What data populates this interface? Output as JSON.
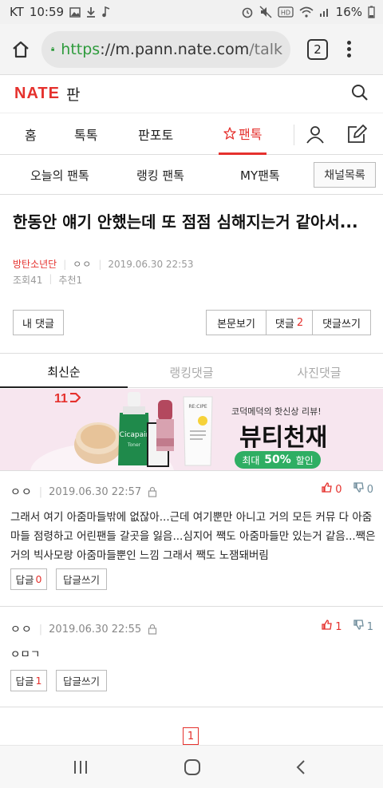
{
  "status_bar": {
    "carrier": "KT",
    "time": "10:59",
    "battery": "16%"
  },
  "browser": {
    "url_scheme": "https",
    "url_rest_host": "://m.pann.nate.com",
    "url_path": "/talk",
    "tab_count": "2"
  },
  "site": {
    "logo": "NATE",
    "logo_sub": "판"
  },
  "main_nav": {
    "items": [
      "홈",
      "톡톡",
      "판포토",
      "팬톡"
    ],
    "active": "팬톡"
  },
  "sub_nav": {
    "items": [
      "오늘의 팬톡",
      "랭킹 팬톡",
      "MY팬톡"
    ],
    "channel_button": "채널목록"
  },
  "post": {
    "title": "한동안 얘기 안했는데 또 점점 심해지는거 같아서...",
    "channel": "방탄소년단",
    "author": "ㅇㅇ",
    "date": "2019.06.30 22:53",
    "views_label": "조회",
    "views": "41",
    "recommend_label": "추천",
    "recommend": "1",
    "my_comments": "내 댓글",
    "view_body": "본문보기",
    "comments_label": "댓글",
    "comments_count": "2",
    "write_comment": "댓글쓰기"
  },
  "comment_tabs": [
    "최신순",
    "랭킹댓글",
    "사진댓글"
  ],
  "ad": {
    "brand": "11",
    "subtitle": "코덕메덕의 핫신상 리뷰!",
    "title": "뷰티천재",
    "pill_prefix": "최대",
    "pill_value": "50%",
    "pill_suffix": "할인",
    "product_label": "Cicapair",
    "product_sub": "Toner",
    "tube_label": "RE:CIPE"
  },
  "comments": [
    {
      "author": "ㅇㅇ",
      "date": "2019.06.30 22:57",
      "up": "0",
      "down": "0",
      "body": "그래서 여기 아줌마들밖에 없잖아...근데 여기뿐만 아니고 거의 모든 커뮤 다 아줌마들 점령하고 어린팬들 갈곳을 잃음...심지어 짹도 아줌마들만 있는거 같음...짹은 거의 빅사모랑 아줌마들뿐인 느낌 그래서 짹도 노잼돼버림",
      "reply_label": "답글",
      "reply_count": "0",
      "write_reply": "답글쓰기"
    },
    {
      "author": "ㅇㅇ",
      "date": "2019.06.30 22:55",
      "up": "1",
      "down": "1",
      "body": "ㅇㅁㄱ",
      "reply_label": "답글",
      "reply_count": "1",
      "write_reply": "답글쓰기"
    }
  ],
  "pagination": {
    "current": "1"
  },
  "colors": {
    "accent": "#e5312d",
    "secure": "#2e9b3c",
    "ad_background": "#f7e6ef",
    "ad_pill": "#2fae63"
  }
}
